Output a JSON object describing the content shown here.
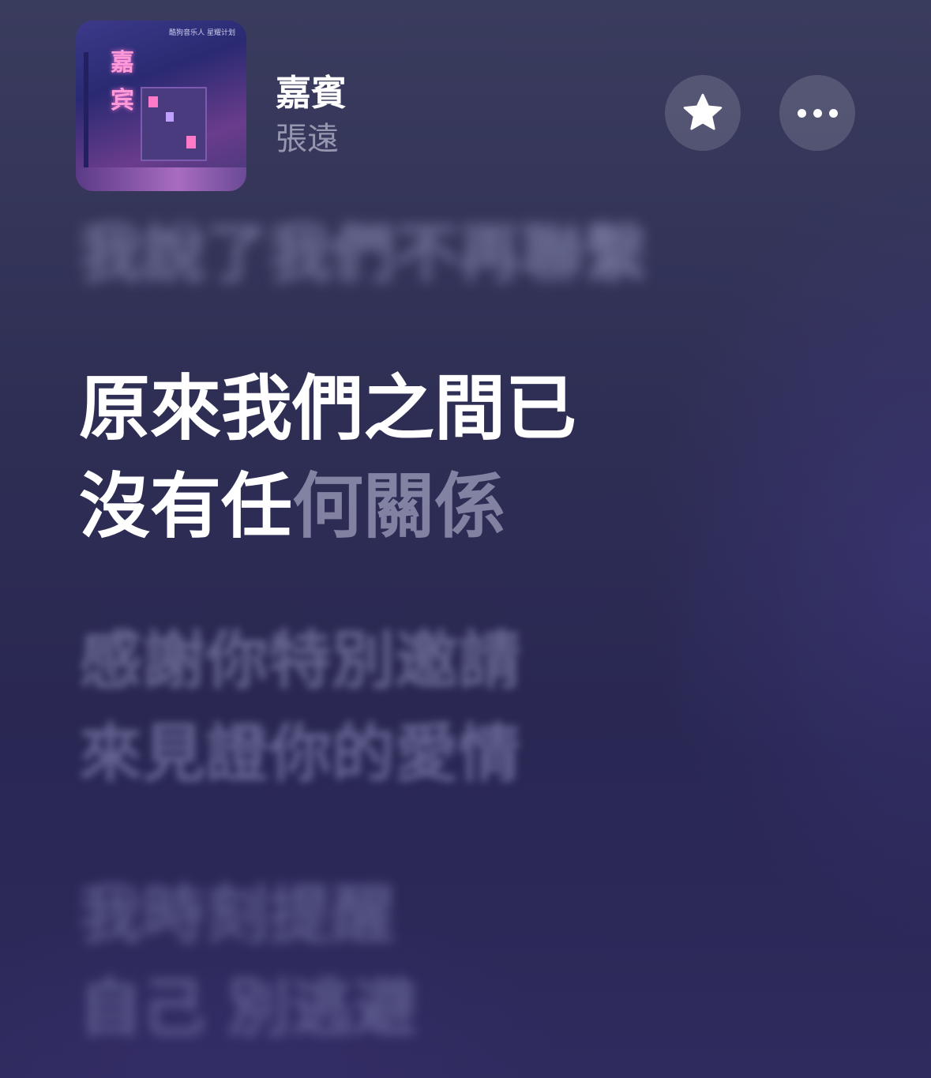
{
  "album_art": {
    "title_text": "嘉宾",
    "credit_text": "酷狗音乐人 星耀计划"
  },
  "song": {
    "title": "嘉賓",
    "artist": "張遠"
  },
  "buttons": {
    "favorite_icon": "star-icon",
    "more_icon": "ellipsis-icon"
  },
  "lyrics": {
    "previous": "我說了我們不再聯繫",
    "current_line1": "原來我們之間已",
    "current_line2_sung": "沒有任",
    "current_line2_pending": "何關係",
    "next1_line1": "感謝你特別邀請",
    "next1_line2": "來見證你的愛情",
    "next2_line1": "我時刻提醒",
    "next2_line2": "自己 別逃避"
  },
  "colors": {
    "background": "#2e2e54",
    "active_lyric": "#ffffff",
    "pending_lyric": "#c8c8e1"
  }
}
